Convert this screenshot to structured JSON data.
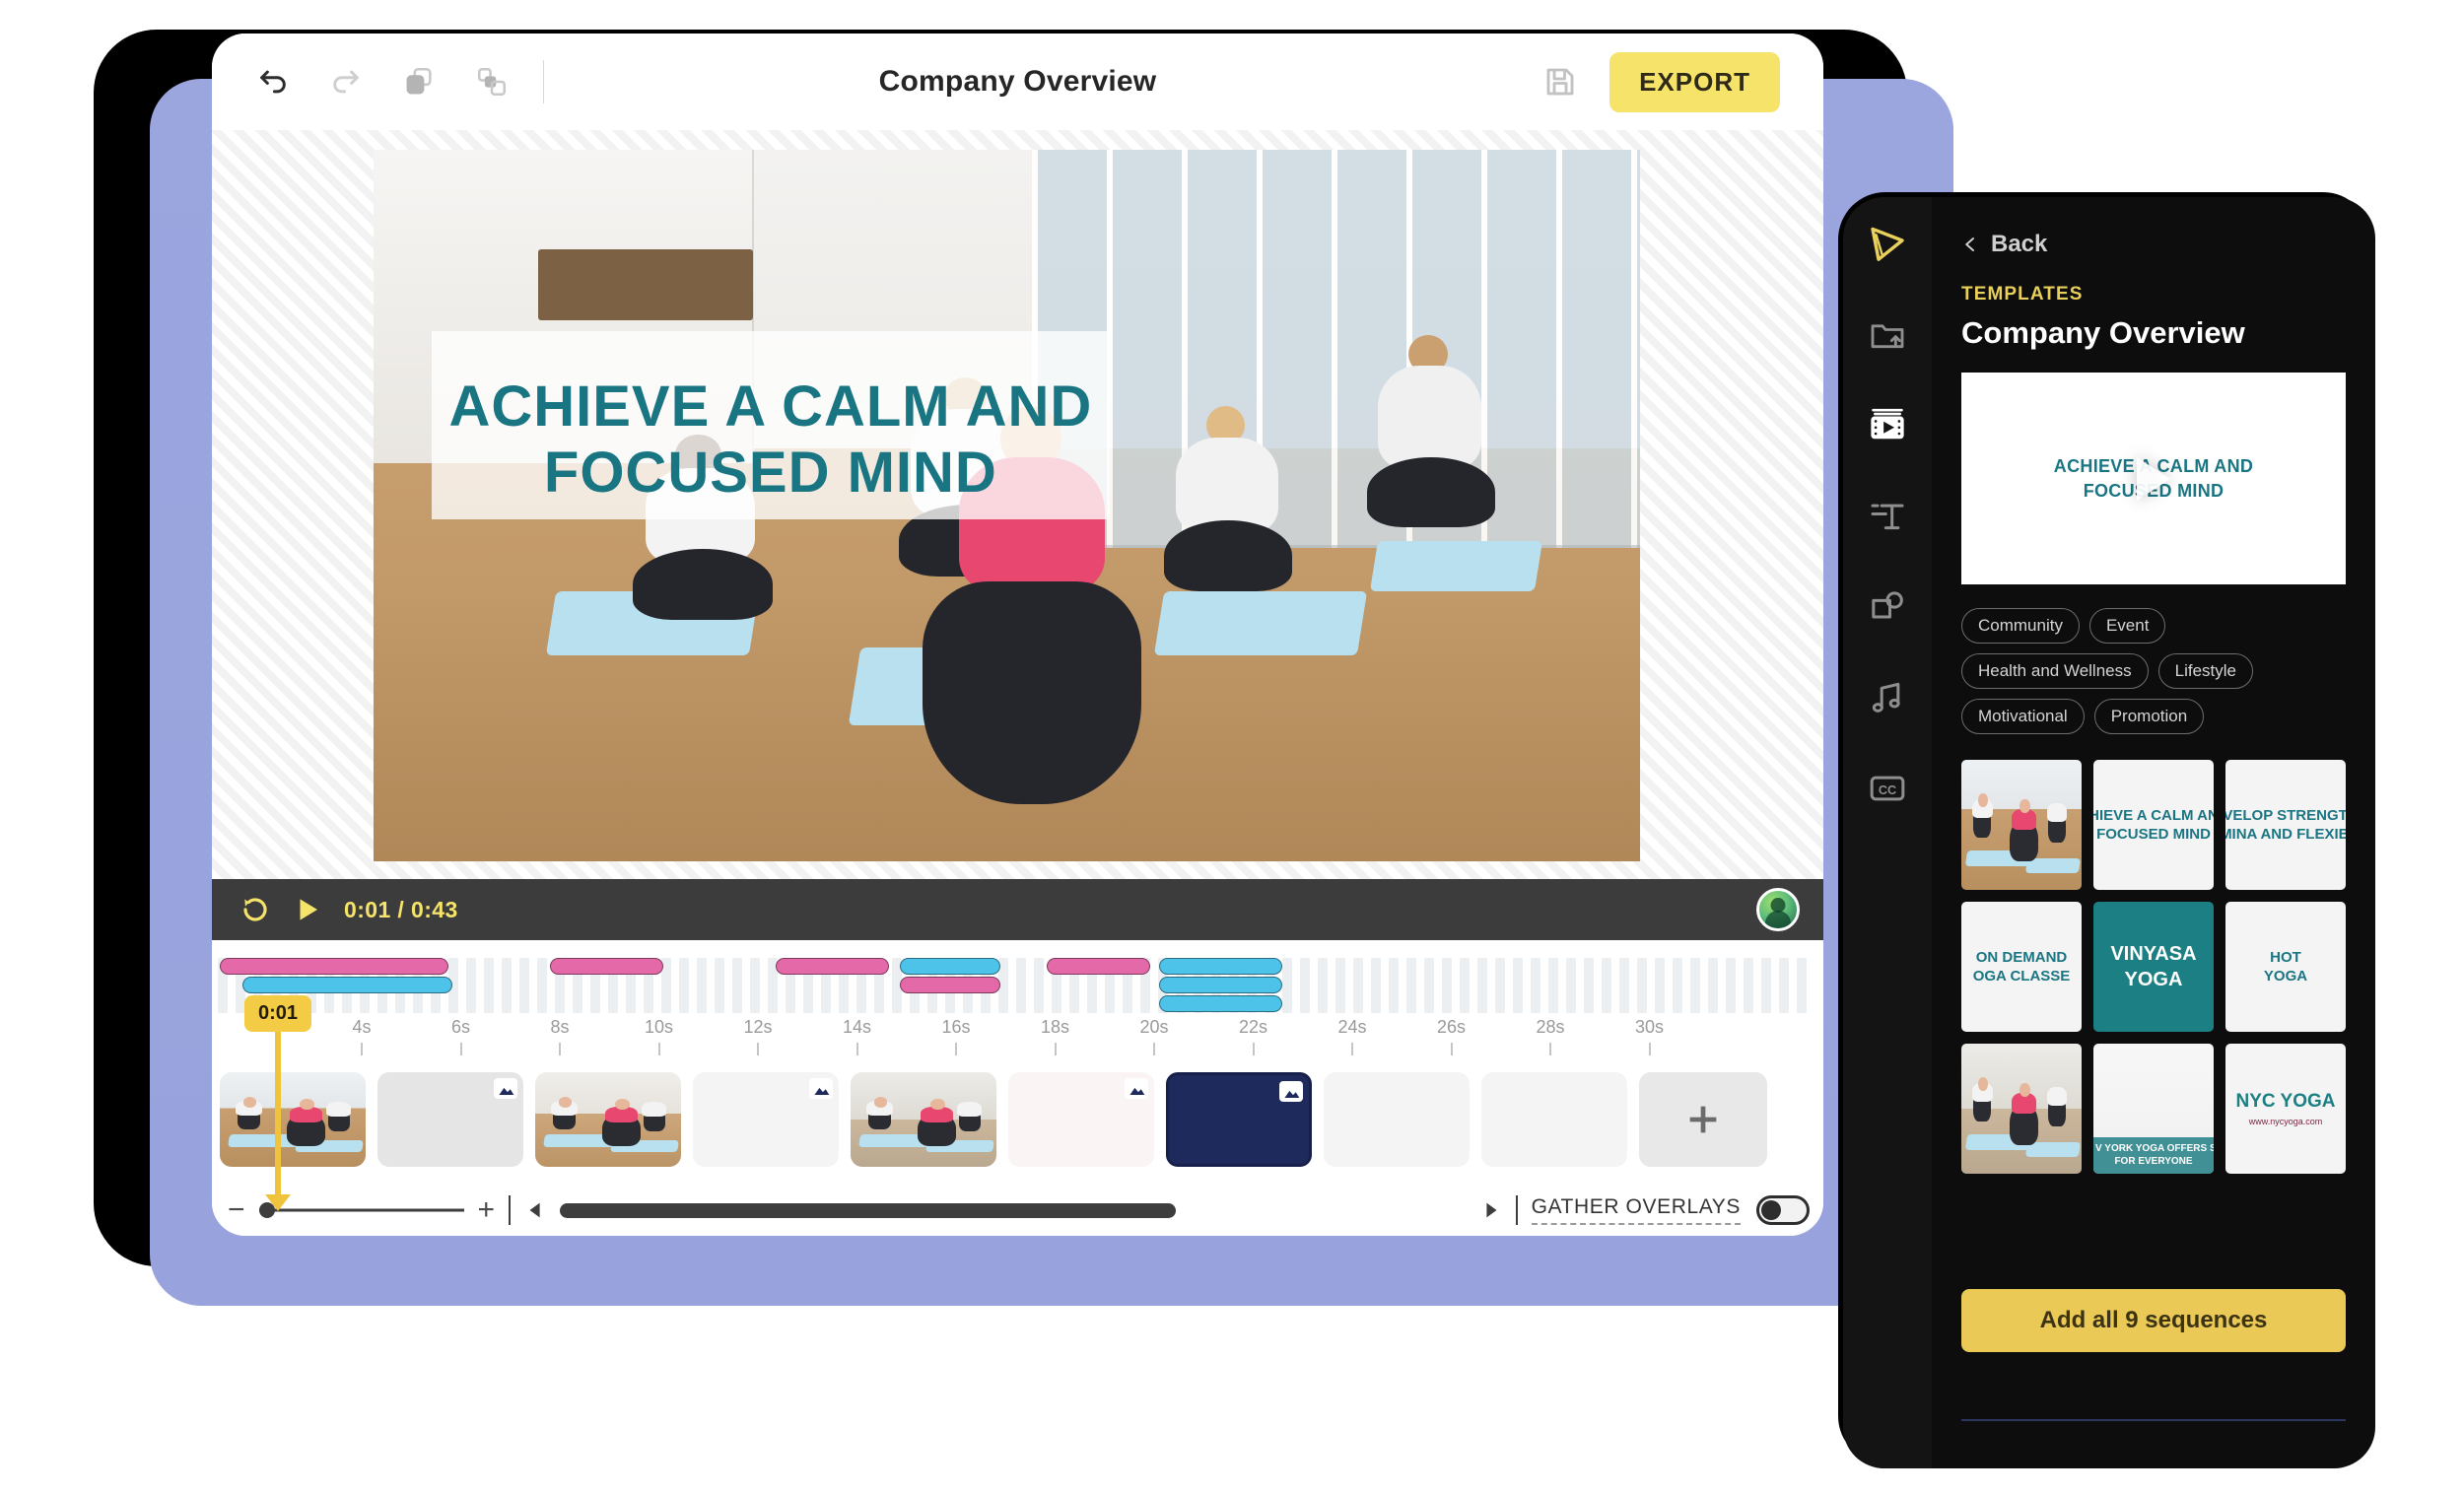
{
  "window": {
    "title": "Company Overview"
  },
  "toolbar": {
    "undo_icon": "undo-icon",
    "redo_icon": "redo-icon",
    "copy_icon": "copy-icon",
    "duplicate_icon": "duplicate-icon",
    "save_icon": "save-icon",
    "export_label": "EXPORT"
  },
  "canvas": {
    "overlay_line_1": "ACHIEVE A CALM AND",
    "overlay_line_2": "FOCUSED MIND",
    "overlay_text_color": "#1a7583"
  },
  "player": {
    "restart_icon": "restart-icon",
    "play_icon": "play-icon",
    "current_time": "0:01",
    "separator": "/",
    "total_time": "0:43",
    "time_display": "0:01 / 0:43",
    "accent_color": "#f5e36a",
    "avatar_icon": "user-avatar"
  },
  "timeline": {
    "playhead_label": "0:01",
    "playhead_color": "#f0c33c",
    "ruler_ticks": [
      "4s",
      "6s",
      "8s",
      "10s",
      "12s",
      "14s",
      "16s",
      "18s",
      "20s",
      "22s",
      "24s",
      "26s",
      "28s",
      "30s"
    ],
    "overlay_bar_colors": {
      "pink": "#e469a8",
      "blue": "#4ec3ea"
    },
    "overlay_bars": [
      {
        "color": "pink",
        "left_pct": 0.5,
        "width_pct": 14.2,
        "row": 0
      },
      {
        "color": "blue",
        "left_pct": 1.9,
        "width_pct": 13.0,
        "row": 1
      },
      {
        "color": "pink",
        "left_pct": 21.0,
        "width_pct": 7.0,
        "row": 0
      },
      {
        "color": "pink",
        "left_pct": 35.0,
        "width_pct": 7.0,
        "row": 0
      },
      {
        "color": "blue",
        "left_pct": 42.7,
        "width_pct": 6.2,
        "row": 0
      },
      {
        "color": "pink",
        "left_pct": 42.7,
        "width_pct": 6.2,
        "row": 1
      },
      {
        "color": "pink",
        "left_pct": 51.8,
        "width_pct": 6.4,
        "row": 0
      },
      {
        "color": "blue",
        "left_pct": 58.8,
        "width_pct": 7.6,
        "row": 0
      },
      {
        "color": "blue",
        "left_pct": 58.8,
        "width_pct": 7.6,
        "row": 1
      },
      {
        "color": "blue",
        "left_pct": 58.8,
        "width_pct": 7.6,
        "row": 2
      }
    ],
    "clips": [
      {
        "kind": "photo",
        "variant": "a",
        "badge": false,
        "selected": false
      },
      {
        "kind": "blank",
        "variant": "gray",
        "badge": true,
        "selected": false
      },
      {
        "kind": "photo",
        "variant": "b",
        "badge": false,
        "selected": false
      },
      {
        "kind": "blank",
        "variant": "light",
        "badge": true,
        "selected": false
      },
      {
        "kind": "photo",
        "variant": "c",
        "badge": false,
        "selected": false
      },
      {
        "kind": "blank",
        "variant": "pink",
        "badge": true,
        "selected": false
      },
      {
        "kind": "blank",
        "variant": "navy",
        "badge": true,
        "selected": true
      },
      {
        "kind": "blank",
        "variant": "light",
        "badge": false,
        "selected": false
      },
      {
        "kind": "blank",
        "variant": "light",
        "badge": false,
        "selected": false
      }
    ],
    "add_clip_label": "+"
  },
  "timeline_controls": {
    "zoom_out_label": "−",
    "zoom_in_label": "+",
    "scroll_left_icon": "caret-left-icon",
    "scroll_right_icon": "caret-right-icon",
    "gather_overlays_label": "GATHER OVERLAYS",
    "gather_overlays_state": "off"
  },
  "panel": {
    "logo_icon": "film-reel-logo",
    "rail_items": [
      {
        "name": "upload-folder-icon",
        "active": false
      },
      {
        "name": "templates-film-icon",
        "active": true
      },
      {
        "name": "text-icon",
        "active": false
      },
      {
        "name": "shapes-icon",
        "active": false
      },
      {
        "name": "music-icon",
        "active": false
      },
      {
        "name": "captions-cc-icon",
        "active": false
      }
    ],
    "back_label": "Back",
    "back_icon": "chevron-left-icon",
    "kicker": "TEMPLATES",
    "title": "Company Overview",
    "preview": {
      "line_1": "ACHIEVE A CALM AND",
      "line_2": "FOCUSED MIND",
      "play_icon": "play-icon"
    },
    "tags": [
      "Community",
      "Event",
      "Health and Wellness",
      "Lifestyle",
      "Motivational",
      "Promotion"
    ],
    "sequences": [
      {
        "type": "photo",
        "variant": "a",
        "text": ""
      },
      {
        "type": "text",
        "variant": "white",
        "text": "CHIEVE A CALM AND\nFOCUSED MIND"
      },
      {
        "type": "text",
        "variant": "white",
        "text": "EVELOP STRENGTH\nAMINA AND FLEXIBIL"
      },
      {
        "type": "text",
        "variant": "white",
        "text": "ON DEMAND\nOGA CLASSE"
      },
      {
        "type": "text",
        "variant": "teal",
        "text": "VINYASA\nYOGA"
      },
      {
        "type": "text",
        "variant": "white",
        "text": "HOT\nYOGA"
      },
      {
        "type": "photo",
        "variant": "b",
        "text": ""
      },
      {
        "type": "band",
        "variant": "white",
        "text": "V YORK YOGA OFFERS SOMETHI\nFOR EVERYONE"
      },
      {
        "type": "nyc",
        "variant": "white",
        "text": "NYC YOGA",
        "subtext": "www.nycyoga.com"
      }
    ],
    "add_all_label": "Add all 9 sequences",
    "accent_yellow": "#eac957"
  }
}
